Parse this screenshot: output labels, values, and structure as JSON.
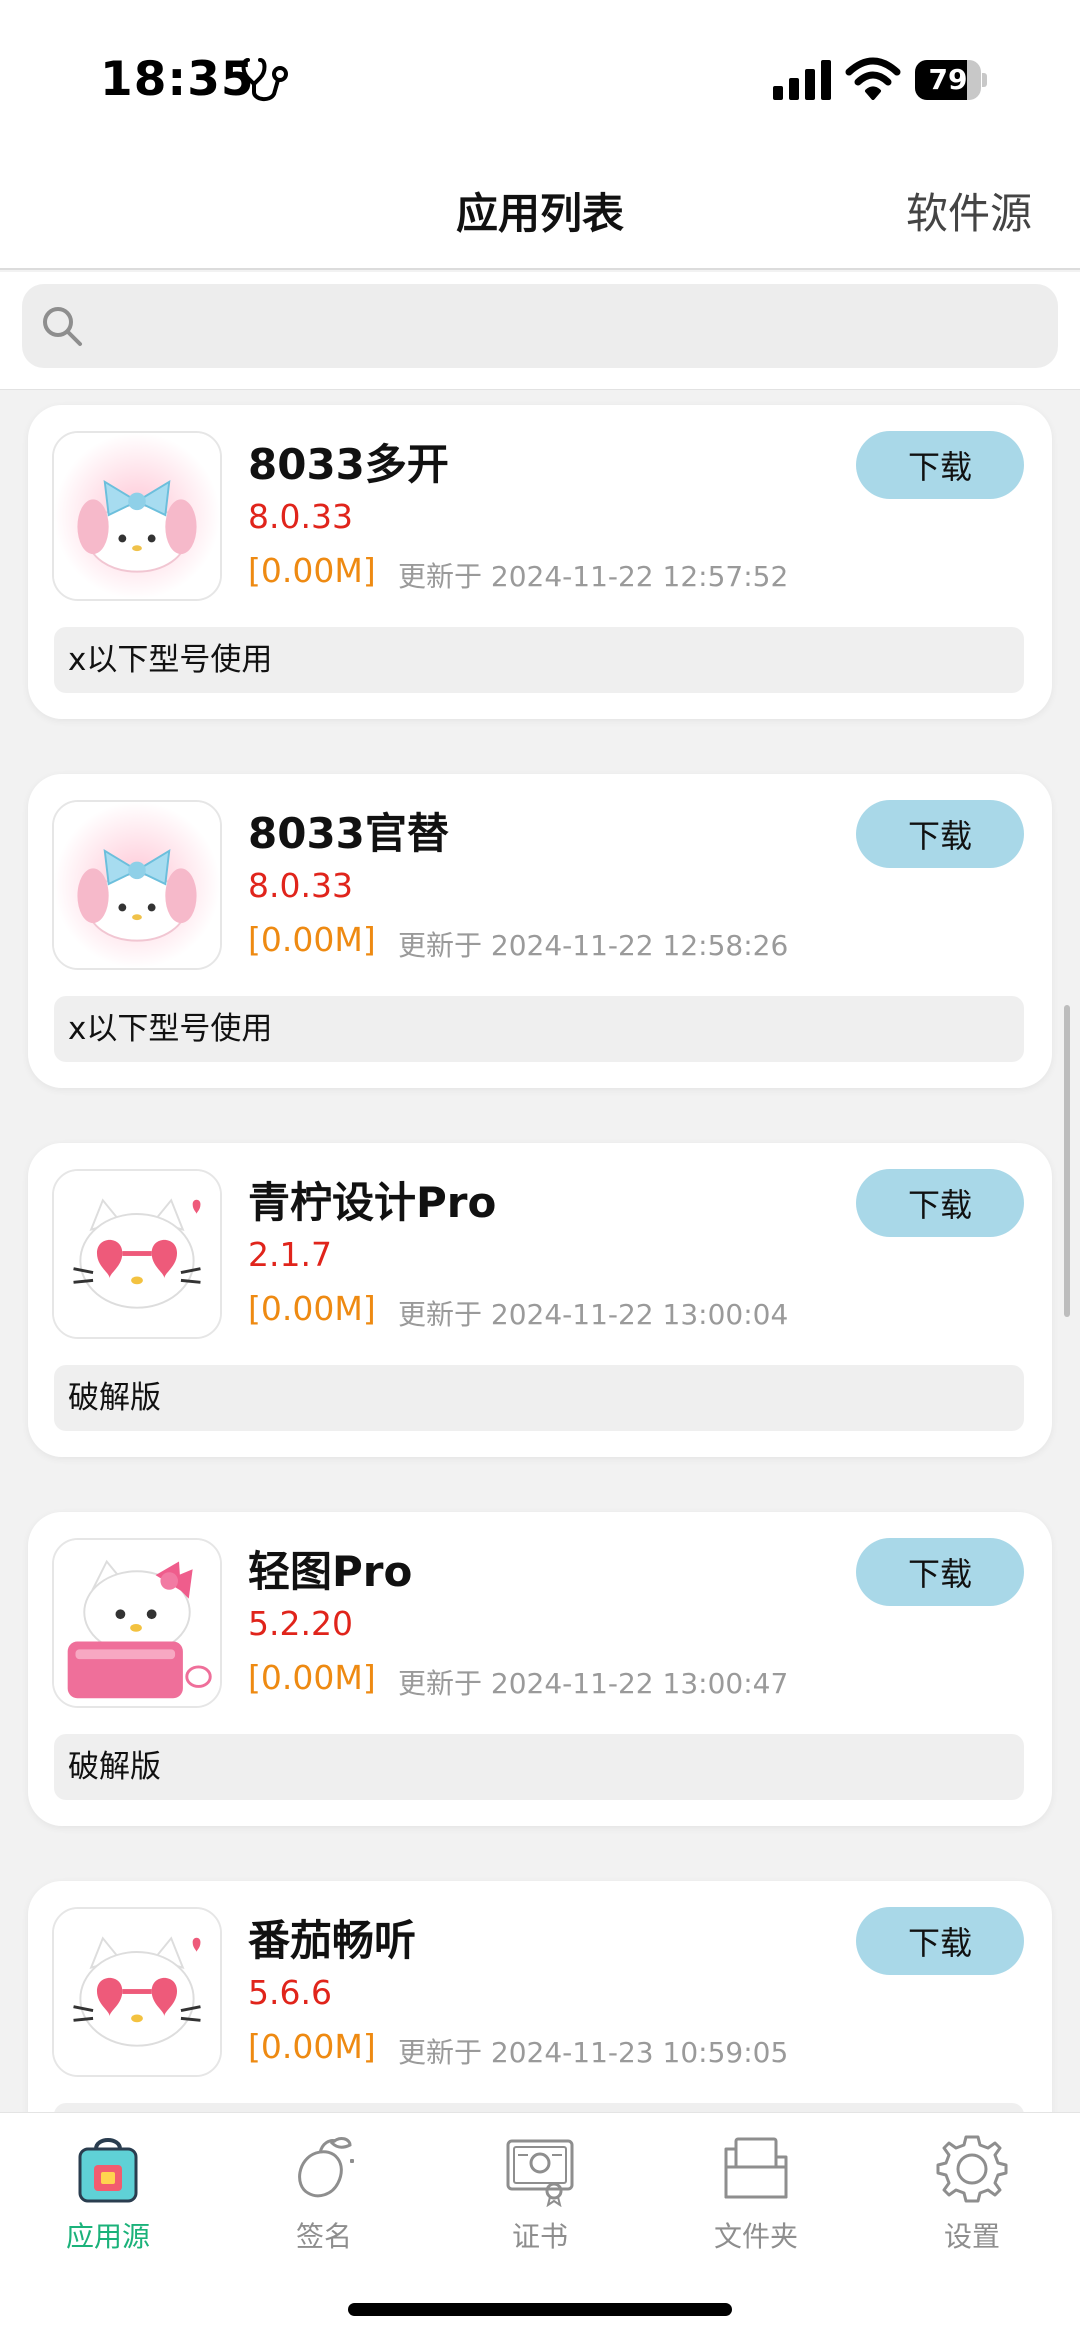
{
  "status_bar": {
    "time": "18:35",
    "battery": 79,
    "battery_text": "79"
  },
  "nav": {
    "title": "应用列表",
    "right_label": "软件源"
  },
  "search": {
    "placeholder": "",
    "value": ""
  },
  "apps": [
    {
      "name": "8033多开",
      "version": "8.0.33",
      "size": "[0.00M]",
      "updated": "更新于 2024-11-22 12:57:52",
      "download": "下载",
      "desc": "x以下型号使用",
      "icon": "my-melody-bow-icon"
    },
    {
      "name": "8033官替",
      "version": "8.0.33",
      "size": "[0.00M]",
      "updated": "更新于 2024-11-22 12:58:26",
      "download": "下载",
      "desc": "x以下型号使用",
      "icon": "my-melody-bow-icon"
    },
    {
      "name": "青柠设计Pro",
      "version": "2.1.7",
      "size": "[0.00M]",
      "updated": "更新于 2024-11-22 13:00:04",
      "download": "下载",
      "desc": "破解版",
      "icon": "hello-kitty-heart-glasses-icon"
    },
    {
      "name": "轻图Pro",
      "version": "5.2.20",
      "size": "[0.00M]",
      "updated": "更新于 2024-11-22 13:00:47",
      "download": "下载",
      "desc": "破解版",
      "icon": "hello-kitty-laptop-icon"
    },
    {
      "name": "番茄畅听",
      "version": "5.6.6",
      "size": "[0.00M]",
      "updated": "更新于 2024-11-23 10:59:05",
      "download": "下载",
      "desc": "",
      "icon": "hello-kitty-heart-glasses-icon"
    }
  ],
  "tabs": [
    {
      "label": "应用源",
      "icon": "shopping-bag-icon",
      "active": true
    },
    {
      "label": "签名",
      "icon": "mango-icon",
      "active": false
    },
    {
      "label": "证书",
      "icon": "certificate-icon",
      "active": false
    },
    {
      "label": "文件夹",
      "icon": "folder-icon",
      "active": false
    },
    {
      "label": "设置",
      "icon": "gear-icon",
      "active": false
    }
  ],
  "colors": {
    "accent_tab": "#1bb27a",
    "download_button": "#a9d8e8",
    "version_red": "#e0241b",
    "size_orange": "#ee8a12"
  }
}
